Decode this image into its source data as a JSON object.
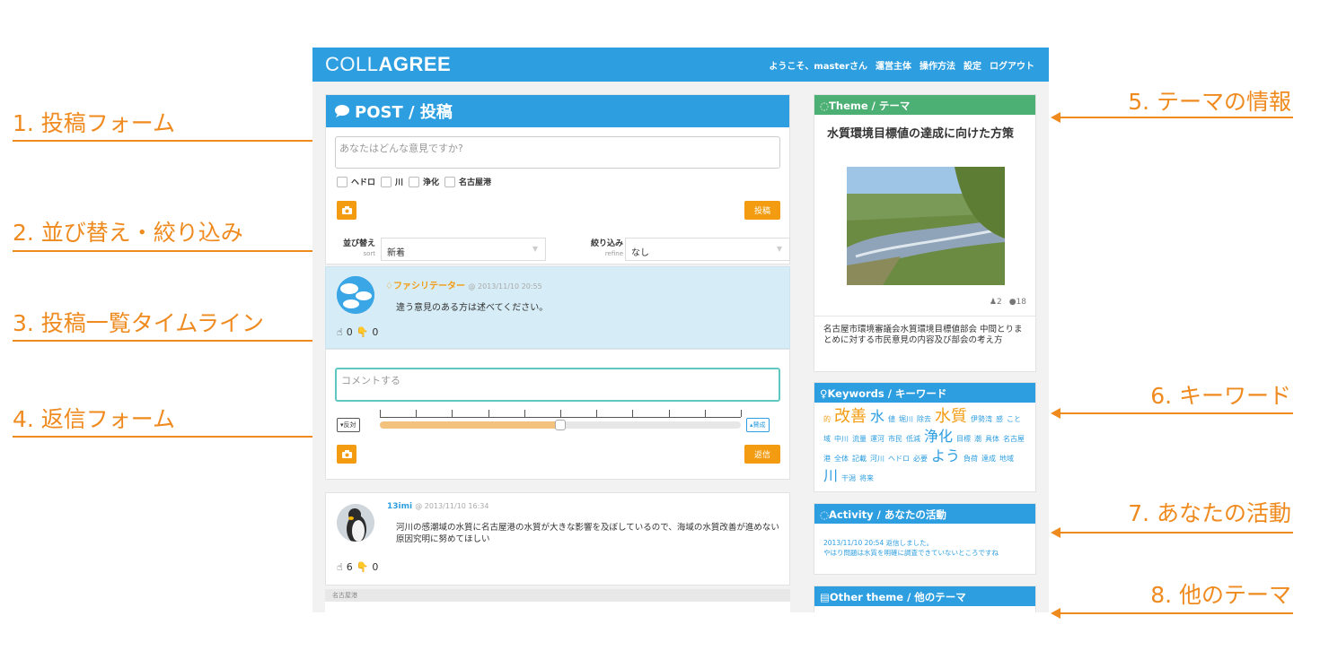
{
  "annotations": {
    "left": [
      {
        "label": "1. 投稿フォーム"
      },
      {
        "label": "2. 並び替え・絞り込み"
      },
      {
        "label": "3. 投稿一覧タイムライン"
      },
      {
        "label": "4. 返信フォーム"
      }
    ],
    "right": [
      {
        "label": "5. テーマの情報"
      },
      {
        "label": "6. キーワード"
      },
      {
        "label": "7. あなたの活動"
      },
      {
        "label": "8. 他のテーマ"
      }
    ],
    "color": "#ef8a1f"
  },
  "app": {
    "brand_light": "COLL",
    "brand_bold": "AGREE",
    "accent": "#2d9ee0",
    "nav": {
      "welcome": "ようこそ、masterさん",
      "operator": "運営主体",
      "howto": "操作方法",
      "settings": "設定",
      "logout": "ログアウト"
    }
  },
  "post_form": {
    "heading": "POST / 投稿",
    "placeholder": "あなたはどんな意見ですか?",
    "tags": [
      "ヘドロ",
      "川",
      "浄化",
      "名古屋港"
    ],
    "submit_label": "投稿",
    "camera_icon": "camera-icon"
  },
  "sort_filter": {
    "sort_label": "並び替え",
    "sort_sub": "sort",
    "sort_value": "新着",
    "refine_label": "絞り込み",
    "refine_sub": "refine",
    "refine_value": "なし"
  },
  "timeline": {
    "facilitator_post": {
      "author": "ファシリテーター",
      "timestamp": "@ 2013/11/10 20:55",
      "text": "違う意見のある方は述べてください。",
      "likes": "0",
      "dislikes": "0"
    },
    "user_post": {
      "author": "13imi",
      "timestamp": "@ 2013/11/10 16:34",
      "text": "河川の感潮域の水質に名古屋港の水質が大きな影響を及ぼしているので、海域の水質改善が進めない原因究明に努めてほしい",
      "likes": "6",
      "dislikes": "0",
      "tag": "名古屋港"
    }
  },
  "reply_form": {
    "placeholder": "コメントする",
    "oppose_label": "反対",
    "agree_label": "賛成",
    "slider_value": 0.5,
    "submit_label": "返信"
  },
  "theme": {
    "heading": "Theme / テーマ",
    "header_color": "#4caf73",
    "title": "水質環境目標値の達成に向けた方策",
    "participants": "2",
    "comments": "18",
    "description": "名古屋市環境審議会水質環境目標値部会 中間とりまとめに対する市民意見の内容及び部会の考え方"
  },
  "keywords": {
    "heading": "Keywords / キーワード",
    "items": [
      {
        "word": "的",
        "size": 8,
        "color": "#f39c12"
      },
      {
        "word": "改善",
        "size": 18,
        "color": "#f39c12"
      },
      {
        "word": "水",
        "size": 16,
        "color": "#2d9ee0"
      },
      {
        "word": "値",
        "size": 8,
        "color": "#2d9ee0"
      },
      {
        "word": "堀川",
        "size": 8,
        "color": "#2d9ee0"
      },
      {
        "word": "除去",
        "size": 8,
        "color": "#2d9ee0"
      },
      {
        "word": "水質",
        "size": 18,
        "color": "#f39c12"
      },
      {
        "word": "伊勢湾",
        "size": 8,
        "color": "#2d9ee0"
      },
      {
        "word": "感",
        "size": 8,
        "color": "#2d9ee0"
      },
      {
        "word": "こと",
        "size": 8,
        "color": "#2d9ee0"
      },
      {
        "word": "域",
        "size": 8,
        "color": "#2d9ee0"
      },
      {
        "word": "中川",
        "size": 8,
        "color": "#2d9ee0"
      },
      {
        "word": "流量",
        "size": 8,
        "color": "#2d9ee0"
      },
      {
        "word": "運河",
        "size": 8,
        "color": "#2d9ee0"
      },
      {
        "word": "市民",
        "size": 8,
        "color": "#2d9ee0"
      },
      {
        "word": "低減",
        "size": 8,
        "color": "#2d9ee0"
      },
      {
        "word": "浄化",
        "size": 16,
        "color": "#2d9ee0"
      },
      {
        "word": "目標",
        "size": 8,
        "color": "#2d9ee0"
      },
      {
        "word": "潮",
        "size": 8,
        "color": "#2d9ee0"
      },
      {
        "word": "具体",
        "size": 8,
        "color": "#2d9ee0"
      },
      {
        "word": "名古屋",
        "size": 8,
        "color": "#2d9ee0"
      },
      {
        "word": "港",
        "size": 8,
        "color": "#2d9ee0"
      },
      {
        "word": "全体",
        "size": 8,
        "color": "#2d9ee0"
      },
      {
        "word": "記載",
        "size": 8,
        "color": "#2d9ee0"
      },
      {
        "word": "河川",
        "size": 8,
        "color": "#2d9ee0"
      },
      {
        "word": "ヘドロ",
        "size": 8,
        "color": "#2d9ee0"
      },
      {
        "word": "必要",
        "size": 8,
        "color": "#2d9ee0"
      },
      {
        "word": "よう",
        "size": 16,
        "color": "#2d9ee0"
      },
      {
        "word": "負荷",
        "size": 8,
        "color": "#2d9ee0"
      },
      {
        "word": "達成",
        "size": 8,
        "color": "#2d9ee0"
      },
      {
        "word": "地域",
        "size": 8,
        "color": "#2d9ee0"
      },
      {
        "word": "川",
        "size": 16,
        "color": "#2d9ee0"
      },
      {
        "word": "干潟",
        "size": 8,
        "color": "#2d9ee0"
      },
      {
        "word": "将来",
        "size": 8,
        "color": "#2d9ee0"
      }
    ]
  },
  "activity": {
    "heading": "Activity / あなたの活動",
    "entry_time": "2013/11/10 20:54 返信しました。",
    "entry_text": "やはり問題は水質を明確に調査できていないところですね"
  },
  "other_theme": {
    "heading": "Other theme / 他のテーマ"
  }
}
